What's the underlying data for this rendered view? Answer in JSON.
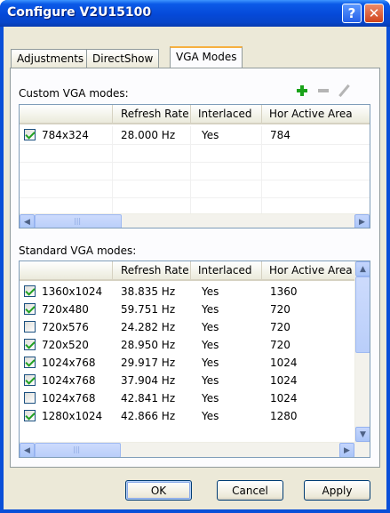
{
  "window": {
    "title": "Configure V2U15100"
  },
  "tabs": [
    {
      "label": "Adjustments"
    },
    {
      "label": "DirectShow"
    },
    {
      "label": "VGA Modes"
    }
  ],
  "custom": {
    "label": "Custom VGA modes:",
    "columns": [
      "",
      "Refresh Rate",
      "Interlaced",
      "Hor Active Area"
    ],
    "rows": [
      {
        "checked": true,
        "mode": "784x324",
        "refresh": "28.000 Hz",
        "interlaced": "Yes",
        "hor": "784"
      }
    ]
  },
  "standard": {
    "label": "Standard VGA modes:",
    "columns": [
      "",
      "Refresh Rate",
      "Interlaced",
      "Hor Active Area"
    ],
    "rows": [
      {
        "checked": true,
        "mode": "1360x1024",
        "refresh": "38.835 Hz",
        "interlaced": "Yes",
        "hor": "1360"
      },
      {
        "checked": true,
        "mode": "720x480",
        "refresh": "59.751 Hz",
        "interlaced": "Yes",
        "hor": "720"
      },
      {
        "checked": false,
        "mode": "720x576",
        "refresh": "24.282 Hz",
        "interlaced": "Yes",
        "hor": "720"
      },
      {
        "checked": true,
        "mode": "720x520",
        "refresh": "28.950 Hz",
        "interlaced": "Yes",
        "hor": "720"
      },
      {
        "checked": true,
        "mode": "1024x768",
        "refresh": "29.917 Hz",
        "interlaced": "Yes",
        "hor": "1024"
      },
      {
        "checked": true,
        "mode": "1024x768",
        "refresh": "37.904 Hz",
        "interlaced": "Yes",
        "hor": "1024"
      },
      {
        "checked": false,
        "mode": "1024x768",
        "refresh": "42.841 Hz",
        "interlaced": "Yes",
        "hor": "1024"
      },
      {
        "checked": true,
        "mode": "1280x1024",
        "refresh": "42.866 Hz",
        "interlaced": "Yes",
        "hor": "1280"
      }
    ]
  },
  "toolbar": {
    "add_icon": "plus-icon",
    "remove_icon": "minus-icon",
    "edit_icon": "pencil-icon"
  },
  "buttons": {
    "ok": "OK",
    "cancel": "Cancel",
    "apply": "Apply"
  },
  "colors": {
    "titlebar": "#0549d8",
    "add": "#1aa31a",
    "checkmark": "#21a121"
  }
}
